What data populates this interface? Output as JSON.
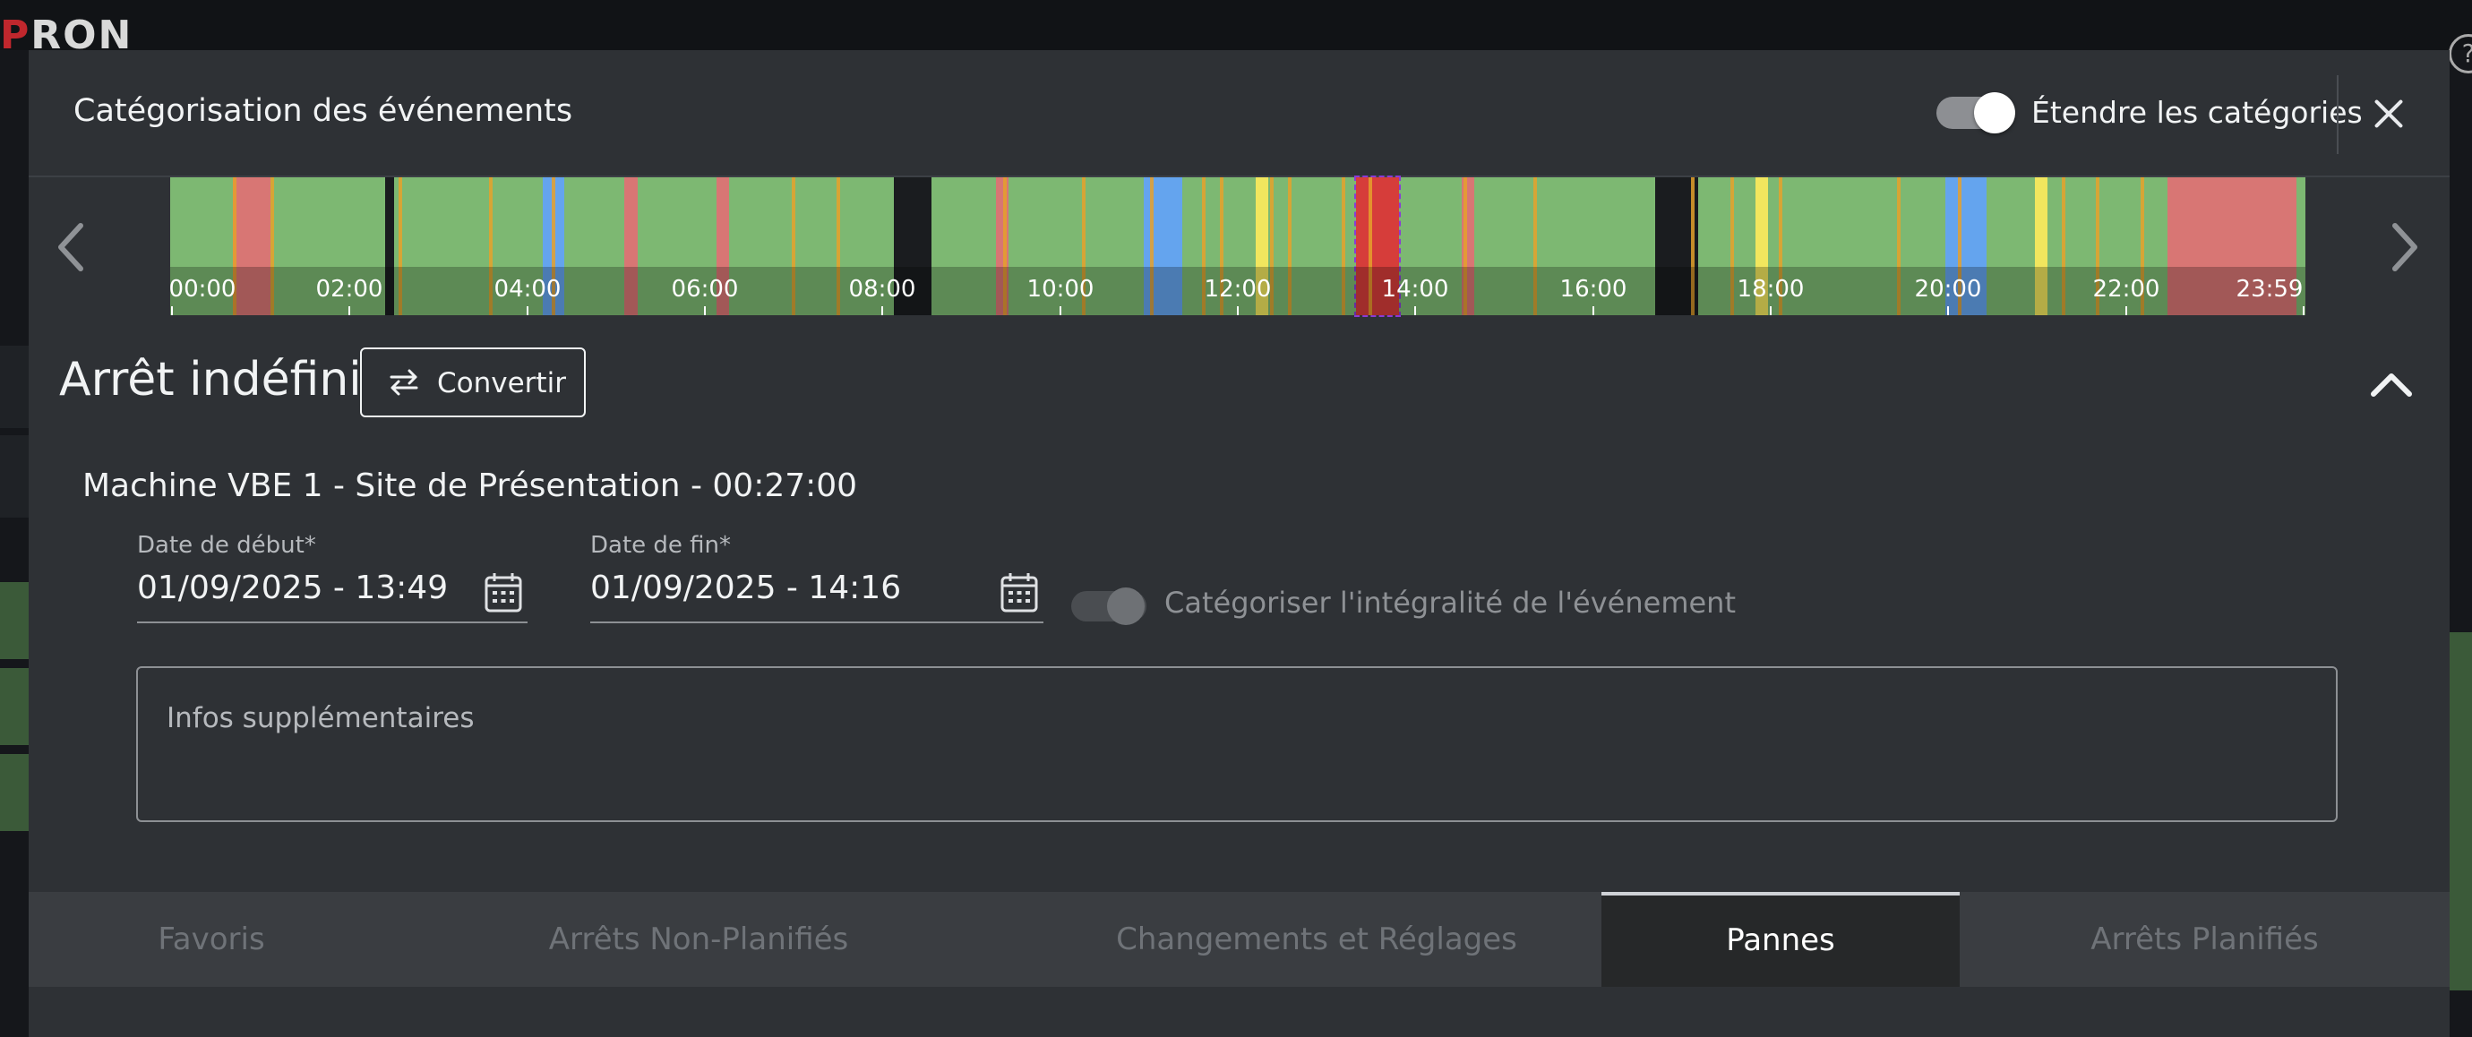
{
  "background": {
    "logo_left": "P",
    "logo_right": "RON",
    "help_icon": "?"
  },
  "modal": {
    "title": "Catégorisation des événements",
    "extend_toggle_label": "Étendre les catégories",
    "extend_toggle_on": true
  },
  "timeline": {
    "ticks": [
      "00:00",
      "02:00",
      "04:00",
      "06:00",
      "08:00",
      "10:00",
      "12:00",
      "14:00",
      "16:00",
      "18:00",
      "20:00",
      "22:00",
      "23:59"
    ],
    "colors": {
      "green": "#7db872",
      "red": "#d87674",
      "selected_red": "#d63d3a",
      "blue": "#64a4ee",
      "yellow": "#f1e65e",
      "orange": "#e5a12b",
      "off": "#1a1c1f"
    }
  },
  "event": {
    "title": "Arrêt indéfini",
    "convert_label": "Convertir",
    "machine_line": "Machine VBE 1 - Site de Présentation - 00:27:00",
    "start_label": "Date de début*",
    "start_value": "01/09/2025 - 13:49",
    "end_label": "Date de fin*",
    "end_value": "01/09/2025 - 14:16",
    "full_event_label": "Catégoriser l'intégralité de l'événement",
    "notes_placeholder": "Infos supplémentaires"
  },
  "tabs": [
    {
      "label": "Favoris",
      "active": false
    },
    {
      "label": "Arrêts Non-Planifiés",
      "active": false
    },
    {
      "label": "Changements et Réglages",
      "active": false
    },
    {
      "label": "Pannes",
      "active": true
    },
    {
      "label": "Arrêts Planifiés",
      "active": false
    }
  ]
}
